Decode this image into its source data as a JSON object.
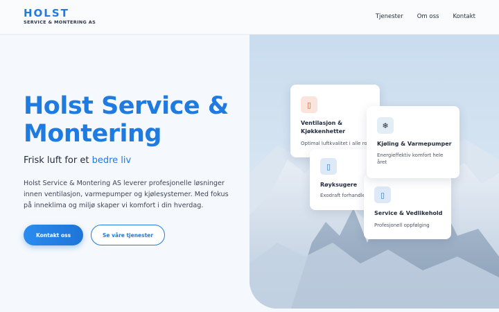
{
  "header": {
    "logo_title": "HOLST",
    "logo_subtitle": "SERVICE & MONTERING AS",
    "nav": [
      "Tjenester",
      "Om oss",
      "Kontakt"
    ]
  },
  "hero": {
    "title": "Holst Service & Montering",
    "tagline_prefix": "Frisk luft for et ",
    "tagline_highlight": "bedre liv",
    "description": "Holst Service & Montering AS leverer profesjonelle løsninger innen ventilasjon, varmepumper og kjølesystemer. Med fokus på inneklima og miljø skaper vi komfort i din hverdag.",
    "primary_button": "Kontakt oss",
    "secondary_button": "Se våre tjenester"
  },
  "services": [
    {
      "title": "Ventilasjon & Kjøkkenhetter",
      "subtitle": "Optimal luftkvalitet i alle rom",
      "icon": "fan-icon",
      "icon_glyph": "▯",
      "color": "#fbe4dc"
    },
    {
      "title": "Kjøling & Varmepumper",
      "subtitle": "Energieffektiv komfort hele året",
      "icon": "snowflake-icon",
      "icon_glyph": "❄",
      "color": "#e3edf5"
    },
    {
      "title": "Røyksugere",
      "subtitle": "Exodraft forhandler",
      "icon": "chimney-icon",
      "icon_glyph": "▯",
      "color": "#dde9f7"
    },
    {
      "title": "Service & Vedlikehold",
      "subtitle": "Profesjonell oppfølging",
      "icon": "wrench-icon",
      "icon_glyph": "▯",
      "color": "#dde9f7"
    }
  ],
  "colors": {
    "accent": "#1f7be0",
    "text": "#1f2a3a"
  }
}
